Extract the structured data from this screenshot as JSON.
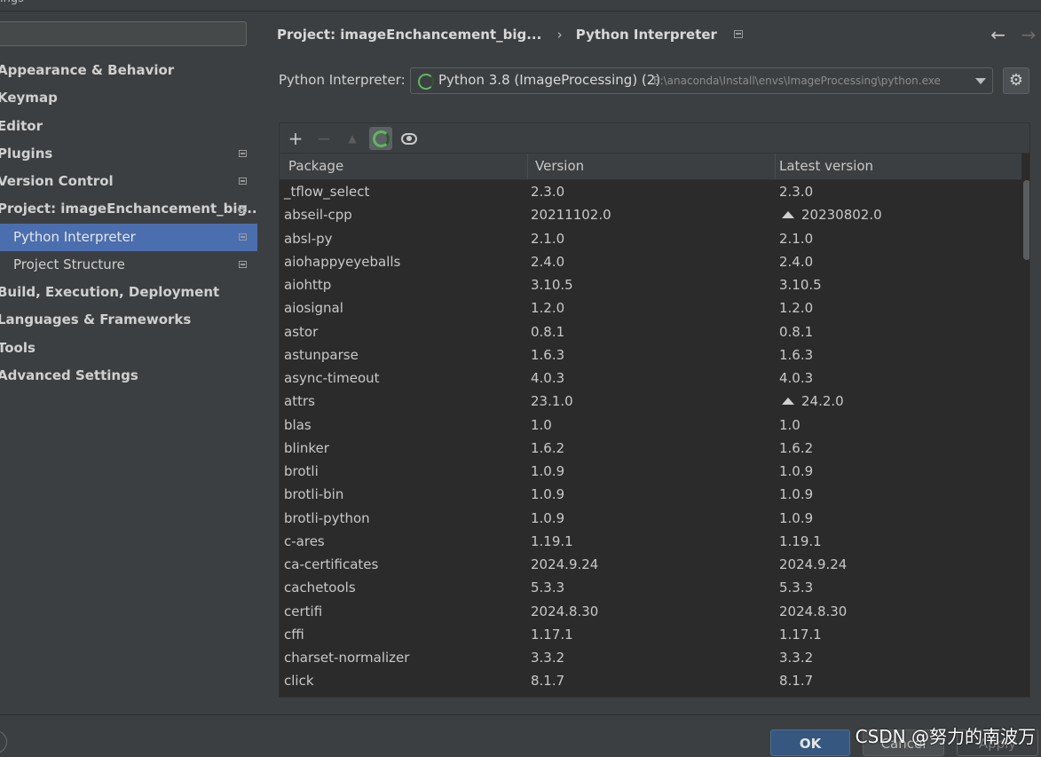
{
  "window": {
    "title_fragment": "ings"
  },
  "sidebar": {
    "search_placeholder": "",
    "items": [
      {
        "label": "Appearance & Behavior"
      },
      {
        "label": "Keymap"
      },
      {
        "label": "Editor"
      },
      {
        "label": "Plugins"
      },
      {
        "label": "Version Control"
      },
      {
        "label": "Project: imageEnchancement_big..."
      },
      {
        "label": "Python Interpreter",
        "selected": true
      },
      {
        "label": "Project Structure"
      },
      {
        "label": "Build, Execution, Deployment"
      },
      {
        "label": "Languages & Frameworks"
      },
      {
        "label": "Tools"
      },
      {
        "label": "Advanced Settings"
      }
    ]
  },
  "header": {
    "breadcrumb_project": "Project: imageEnchancement_big...",
    "breadcrumb_separator": "›",
    "breadcrumb_page": "Python Interpreter",
    "back_icon": "←",
    "forward_icon": "→"
  },
  "interpreter": {
    "label": "Python Interpreter:",
    "name": "Python 3.8 (ImageProcessing) (2)",
    "path": "E:\\anaconda\\Install\\envs\\ImageProcessing\\python.exe"
  },
  "toolbar": {
    "add_icon": "+",
    "remove_icon": "−",
    "upgrade_icon": "▲",
    "settings_icon": "⚙"
  },
  "table": {
    "headers": [
      "Package",
      "Version",
      "Latest version"
    ],
    "rows": [
      {
        "package": "_tflow_select",
        "version": "2.3.0",
        "latest": "2.3.0",
        "upgrade": false
      },
      {
        "package": "abseil-cpp",
        "version": "20211102.0",
        "latest": "20230802.0",
        "upgrade": true
      },
      {
        "package": "absl-py",
        "version": "2.1.0",
        "latest": "2.1.0",
        "upgrade": false
      },
      {
        "package": "aiohappyeyeballs",
        "version": "2.4.0",
        "latest": "2.4.0",
        "upgrade": false
      },
      {
        "package": "aiohttp",
        "version": "3.10.5",
        "latest": "3.10.5",
        "upgrade": false
      },
      {
        "package": "aiosignal",
        "version": "1.2.0",
        "latest": "1.2.0",
        "upgrade": false
      },
      {
        "package": "astor",
        "version": "0.8.1",
        "latest": "0.8.1",
        "upgrade": false
      },
      {
        "package": "astunparse",
        "version": "1.6.3",
        "latest": "1.6.3",
        "upgrade": false
      },
      {
        "package": "async-timeout",
        "version": "4.0.3",
        "latest": "4.0.3",
        "upgrade": false
      },
      {
        "package": "attrs",
        "version": "23.1.0",
        "latest": "24.2.0",
        "upgrade": true
      },
      {
        "package": "blas",
        "version": "1.0",
        "latest": "1.0",
        "upgrade": false
      },
      {
        "package": "blinker",
        "version": "1.6.2",
        "latest": "1.6.2",
        "upgrade": false
      },
      {
        "package": "brotli",
        "version": "1.0.9",
        "latest": "1.0.9",
        "upgrade": false
      },
      {
        "package": "brotli-bin",
        "version": "1.0.9",
        "latest": "1.0.9",
        "upgrade": false
      },
      {
        "package": "brotli-python",
        "version": "1.0.9",
        "latest": "1.0.9",
        "upgrade": false
      },
      {
        "package": "c-ares",
        "version": "1.19.1",
        "latest": "1.19.1",
        "upgrade": false
      },
      {
        "package": "ca-certificates",
        "version": "2024.9.24",
        "latest": "2024.9.24",
        "upgrade": false
      },
      {
        "package": "cachetools",
        "version": "5.3.3",
        "latest": "5.3.3",
        "upgrade": false
      },
      {
        "package": "certifi",
        "version": "2024.8.30",
        "latest": "2024.8.30",
        "upgrade": false
      },
      {
        "package": "cffi",
        "version": "1.17.1",
        "latest": "1.17.1",
        "upgrade": false
      },
      {
        "package": "charset-normalizer",
        "version": "3.3.2",
        "latest": "3.3.2",
        "upgrade": false
      },
      {
        "package": "click",
        "version": "8.1.7",
        "latest": "8.1.7",
        "upgrade": false
      }
    ]
  },
  "footer": {
    "ok_label": "OK",
    "cancel_label": "Cancel",
    "apply_label": "Apply",
    "watermark": "CSDN @努力的南波万"
  }
}
